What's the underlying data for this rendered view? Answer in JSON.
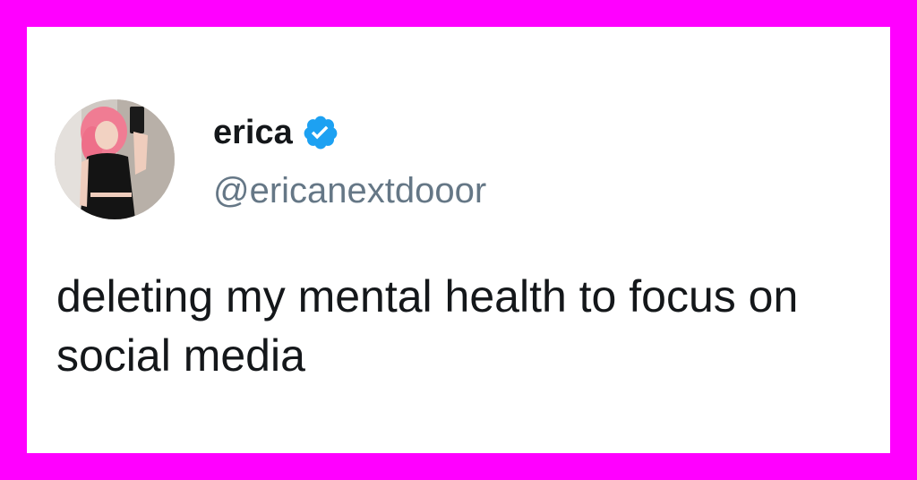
{
  "colors": {
    "frame_border": "#ff00ff",
    "card_background": "#ffffff",
    "name_text": "#14171a",
    "handle_text": "#657786",
    "verified_badge": "#1da1f2"
  },
  "tweet": {
    "user": {
      "display_name": "erica",
      "handle": "@ericanextdooor",
      "verified": true,
      "verified_icon": "verified-badge-icon",
      "avatar_icon": "profile-photo"
    },
    "text": "deleting my mental health to focus on social media"
  }
}
